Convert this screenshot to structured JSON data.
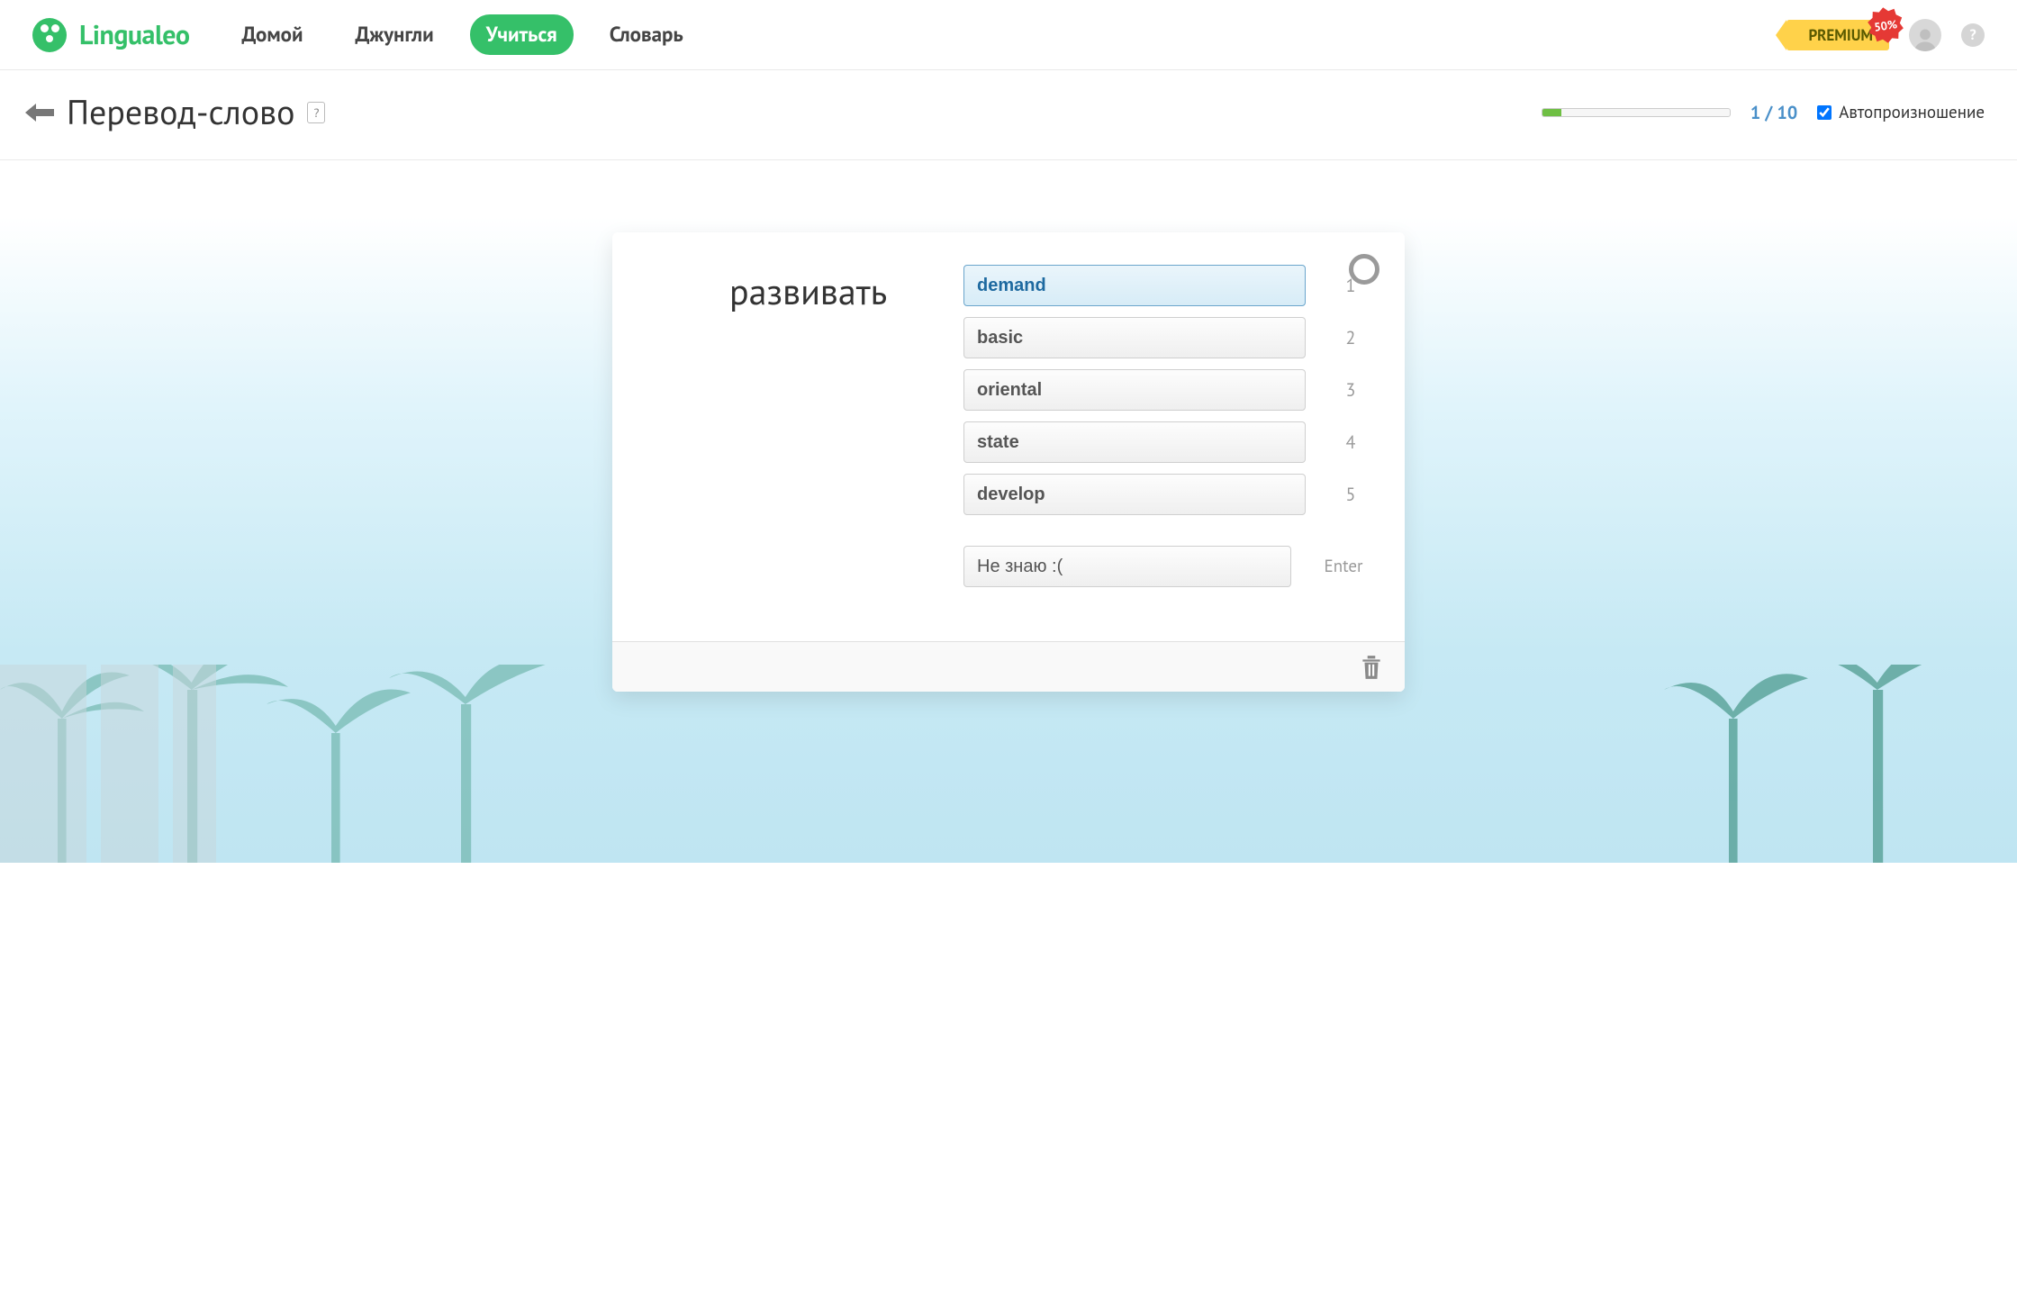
{
  "brand": {
    "name": "Lingualeo"
  },
  "nav": {
    "items": [
      {
        "label": "Домой",
        "active": false
      },
      {
        "label": "Джунгли",
        "active": false
      },
      {
        "label": "Учиться",
        "active": true
      },
      {
        "label": "Словарь",
        "active": false
      }
    ]
  },
  "premium": {
    "label": "PREMIUM",
    "discount": "50%"
  },
  "page": {
    "title": "Перевод-слово",
    "help": "?"
  },
  "progress": {
    "current": "1",
    "total": "10",
    "separator": " / ",
    "percent": 10
  },
  "autoplay": {
    "label": "Автопроизношение",
    "checked": true
  },
  "exercise": {
    "term": "развивать",
    "options": [
      {
        "label": "demand",
        "key": "1",
        "selected": true
      },
      {
        "label": "basic",
        "key": "2",
        "selected": false
      },
      {
        "label": "oriental",
        "key": "3",
        "selected": false
      },
      {
        "label": "state",
        "key": "4",
        "selected": false
      },
      {
        "label": "develop",
        "key": "5",
        "selected": false
      }
    ],
    "dont_know": {
      "label": "Не знаю :(",
      "key": "Enter"
    }
  },
  "colors": {
    "brand_green": "#35c069",
    "option_selected_border": "#6aa5cc",
    "premium_yellow": "#ffd24a",
    "discount_red": "#e53935"
  }
}
